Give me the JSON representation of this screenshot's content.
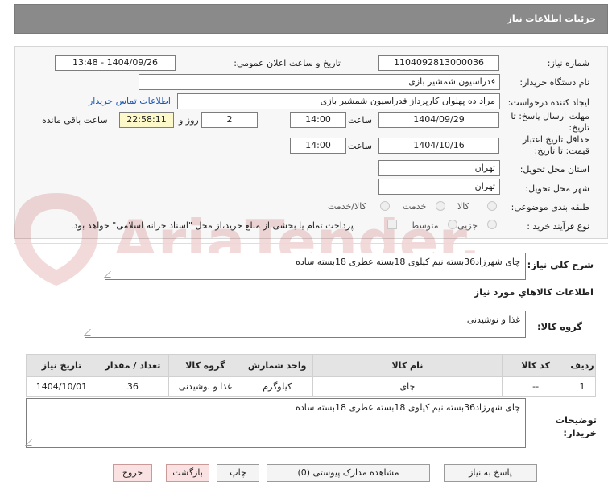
{
  "header": {
    "title": "جزئیات اطلاعات نیاز"
  },
  "form": {
    "need_number_label": "شماره نیاز:",
    "need_number": "1104092813000036",
    "announce_label": "تاریخ و ساعت اعلان عمومی:",
    "announce_value": "1404/09/26 - 13:48",
    "buyer_label": "نام دستگاه خریدار:",
    "buyer_value": "فدراسیون شمشیر بازی",
    "requester_label": "ایجاد کننده درخواست:",
    "requester_value": "مراد ده پهلوان کارپرداز فدراسیون شمشیر بازی",
    "contact_link": "اطلاعات تماس خریدار",
    "deadline_label_1": "مهلت ارسال پاسخ: تا",
    "deadline_label_2": "تاریخ:",
    "deadline_date": "1404/09/29",
    "time_label": "ساعت",
    "deadline_time": "14:00",
    "days_value": "2",
    "days_label": "روز و",
    "remaining_time": "22:58:11",
    "remaining_label": "ساعت باقی مانده",
    "validity_label_1": "حداقل تاریخ اعتبار",
    "validity_label_2": "قیمت: تا تاریخ:",
    "validity_date": "1404/10/16",
    "validity_time": "14:00",
    "province_label": "استان محل تحویل:",
    "province_value": "تهران",
    "city_label": "شهر محل تحویل:",
    "city_value": "تهران",
    "category_label": "طبقه بندی موضوعی:",
    "category_options": [
      "کالا",
      "خدمت",
      "کالا/خدمت"
    ],
    "process_label": "نوع فرآیند خرید :",
    "process_options": [
      "جزیی",
      "متوسط"
    ],
    "payment_note": "پرداخت تمام یا بخشی از مبلغ خرید،از محل \"اسناد خزانه اسلامی\" خواهد بود."
  },
  "description": {
    "label": "شرح کلي نياز:",
    "value": "چای شهرزاد36بسته نیم کیلوی 18بسته عطری 18بسته ساده"
  },
  "goods_info": {
    "title": "اطلاعات كالاهاي مورد نياز",
    "group_label": "گروه کالا:",
    "group_value": "غذا و نوشیدنی"
  },
  "table": {
    "headers": [
      "ردیف",
      "کد کالا",
      "نام کالا",
      "واحد شمارش",
      "گروه کالا",
      "تعداد / مقدار",
      "تاریخ نیاز"
    ],
    "rows": [
      [
        "1",
        "--",
        "چای",
        "کیلوگرم",
        "غذا و نوشیدنی",
        "36",
        "1404/10/01"
      ]
    ]
  },
  "buyer_notes": {
    "label_1": "توضیحات",
    "label_2": "خریدار:",
    "value": "چای شهرزاد36بسته نیم کیلوی 18بسته عطری 18بسته ساده"
  },
  "buttons": {
    "reply": "پاسخ به نیاز",
    "docs": "مشاهده مدارک پیوستی (0)",
    "print": "چاپ",
    "back": "بازگشت",
    "exit": "خروج"
  },
  "watermark": {
    "text": "AriaTender.net"
  }
}
